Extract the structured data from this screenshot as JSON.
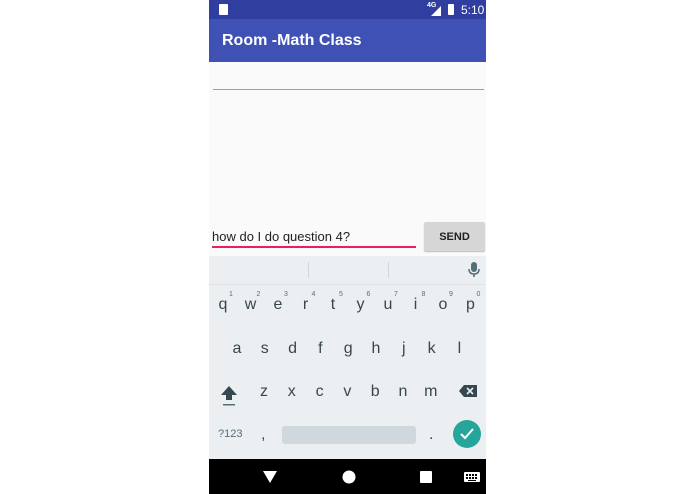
{
  "status_bar": {
    "network": "4G",
    "time": "5:10"
  },
  "app_bar": {
    "title": "Room -Math Class"
  },
  "chat": {
    "room_field_value": "",
    "message_value": "how do I do question 4?",
    "send_label": "SEND"
  },
  "keyboard": {
    "row1": [
      {
        "k": "q",
        "n": "1"
      },
      {
        "k": "w",
        "n": "2"
      },
      {
        "k": "e",
        "n": "3"
      },
      {
        "k": "r",
        "n": "4"
      },
      {
        "k": "t",
        "n": "5"
      },
      {
        "k": "y",
        "n": "6"
      },
      {
        "k": "u",
        "n": "7"
      },
      {
        "k": "i",
        "n": "8"
      },
      {
        "k": "o",
        "n": "9"
      },
      {
        "k": "p",
        "n": "0"
      }
    ],
    "row2": [
      "a",
      "s",
      "d",
      "f",
      "g",
      "h",
      "j",
      "k",
      "l"
    ],
    "row3": [
      "z",
      "x",
      "c",
      "v",
      "b",
      "n",
      "m"
    ],
    "sym_label": "?123",
    "comma": ",",
    "period": "."
  },
  "icons": [
    "sd-card-icon",
    "signal-icon",
    "battery-icon",
    "mic-icon",
    "shift-icon",
    "backspace-icon",
    "enter-check-icon",
    "back-triangle-icon",
    "home-circle-icon",
    "recents-square-icon",
    "keyboard-icon"
  ],
  "colors": {
    "status_bar": "#303f9f",
    "app_bar": "#3f51b5",
    "input_underline": "#e91e63",
    "enter_key": "#26a69a"
  }
}
